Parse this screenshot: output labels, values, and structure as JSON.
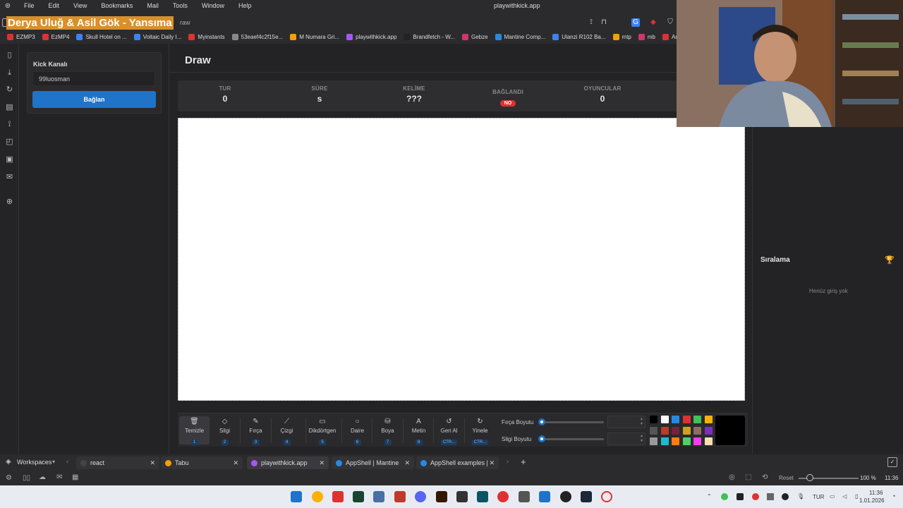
{
  "browser": {
    "menu": [
      "File",
      "Edit",
      "View",
      "Bookmarks",
      "Mail",
      "Tools",
      "Window",
      "Help"
    ],
    "window_title": "playwithkick.app",
    "overlay_banner": "Derya Uluğ & Asil Gök - Yansıma",
    "url_fragment": "raw",
    "bookmarks": [
      "EZMP3",
      "EzMP4",
      "Skull Hotel on ...",
      "Voltaic Daily I...",
      "Myinstants",
      "53eaef4c2f15e...",
      "M Numara Gri...",
      "playwithkick.app",
      "Brandfetch - W...",
      "Gebze",
      "Mantine Comp...",
      "Ulanzi R102 Ba...",
      "mtp",
      "mb",
      "Arşiv"
    ],
    "bookmark_colors": [
      "#e03131",
      "#e03131",
      "#3b82f6",
      "#3b82f6",
      "#e03131",
      "#888888",
      "#f59f00",
      "#a855f7",
      "#222222",
      "#d6336c",
      "#228be6",
      "#3b82f6",
      "#f59f00",
      "#d6336c",
      "#e03131"
    ]
  },
  "sidebar": {
    "kick_label": "Kick Kanalı",
    "kick_value": "99luosman",
    "connect_label": "Bağlan"
  },
  "main": {
    "title": "Draw",
    "stats": [
      {
        "label": "TUR",
        "value": "0"
      },
      {
        "label": "SÜRE",
        "value": "s"
      },
      {
        "label": "KELİME",
        "value": "???"
      },
      {
        "label": "BAĞLANDI",
        "value": "NO"
      },
      {
        "label": "OYUNCULAR",
        "value": "0"
      }
    ]
  },
  "ranking": {
    "title": "Sıralama",
    "empty": "Henüz giriş yok"
  },
  "toolbar": {
    "tools": [
      {
        "label": "Temizle",
        "key": "1",
        "icon": "trash-icon",
        "glyph": "🗑"
      },
      {
        "label": "Silgi",
        "key": "2",
        "icon": "eraser-icon",
        "glyph": "◇"
      },
      {
        "label": "Fırça",
        "key": "3",
        "icon": "brush-icon",
        "glyph": "✎"
      },
      {
        "label": "Çizgi",
        "key": "4",
        "icon": "line-icon",
        "glyph": "⟋"
      },
      {
        "label": "Dikdörtgen",
        "key": "5",
        "icon": "rectangle-icon",
        "glyph": "▭"
      },
      {
        "label": "Daire",
        "key": "6",
        "icon": "circle-icon",
        "glyph": "○"
      },
      {
        "label": "Boya",
        "key": "7",
        "icon": "bucket-icon",
        "glyph": "⛁"
      },
      {
        "label": "Metin",
        "key": "8",
        "icon": "text-icon",
        "glyph": "A"
      },
      {
        "label": "Geri Al",
        "key": "CTR...",
        "icon": "undo-icon",
        "glyph": "↺"
      },
      {
        "label": "Yinele",
        "key": "CTR...",
        "icon": "redo-icon",
        "glyph": "↻"
      }
    ],
    "brush_size_label": "Fırça Boyutu",
    "eraser_size_label": "Silgi Boyutu",
    "brush_size_value": 0,
    "eraser_size_value": 0,
    "palette": [
      "#000000",
      "#ffffff",
      "#228be6",
      "#e03131",
      "#40c057",
      "#fab005",
      "#555555",
      "#c0392b",
      "#7a1f3d",
      "#d4a017",
      "#8d6e63",
      "#7b2fbe",
      "#999999",
      "#22b8cf",
      "#fd7e14",
      "#51cf66",
      "#f03ee8",
      "#f5deb3"
    ],
    "current_color": "#000000"
  },
  "tabs": {
    "workspaces_label": "Workspaces",
    "items": [
      {
        "label": "react",
        "color": "#444444"
      },
      {
        "label": "Tabu",
        "color": "#f59f00"
      },
      {
        "label": "playwithkick.app",
        "color": "#a855f7"
      },
      {
        "label": "AppShell | Mantine",
        "color": "#228be6"
      },
      {
        "label": "AppShell examples | M",
        "color": "#228be6"
      }
    ]
  },
  "statusbar": {
    "reset_label": "Reset",
    "zoom": "100 %",
    "time": "11:36"
  },
  "taskbar": {
    "lang": "TUR",
    "time": "11:36",
    "date": "1.01.2026"
  }
}
